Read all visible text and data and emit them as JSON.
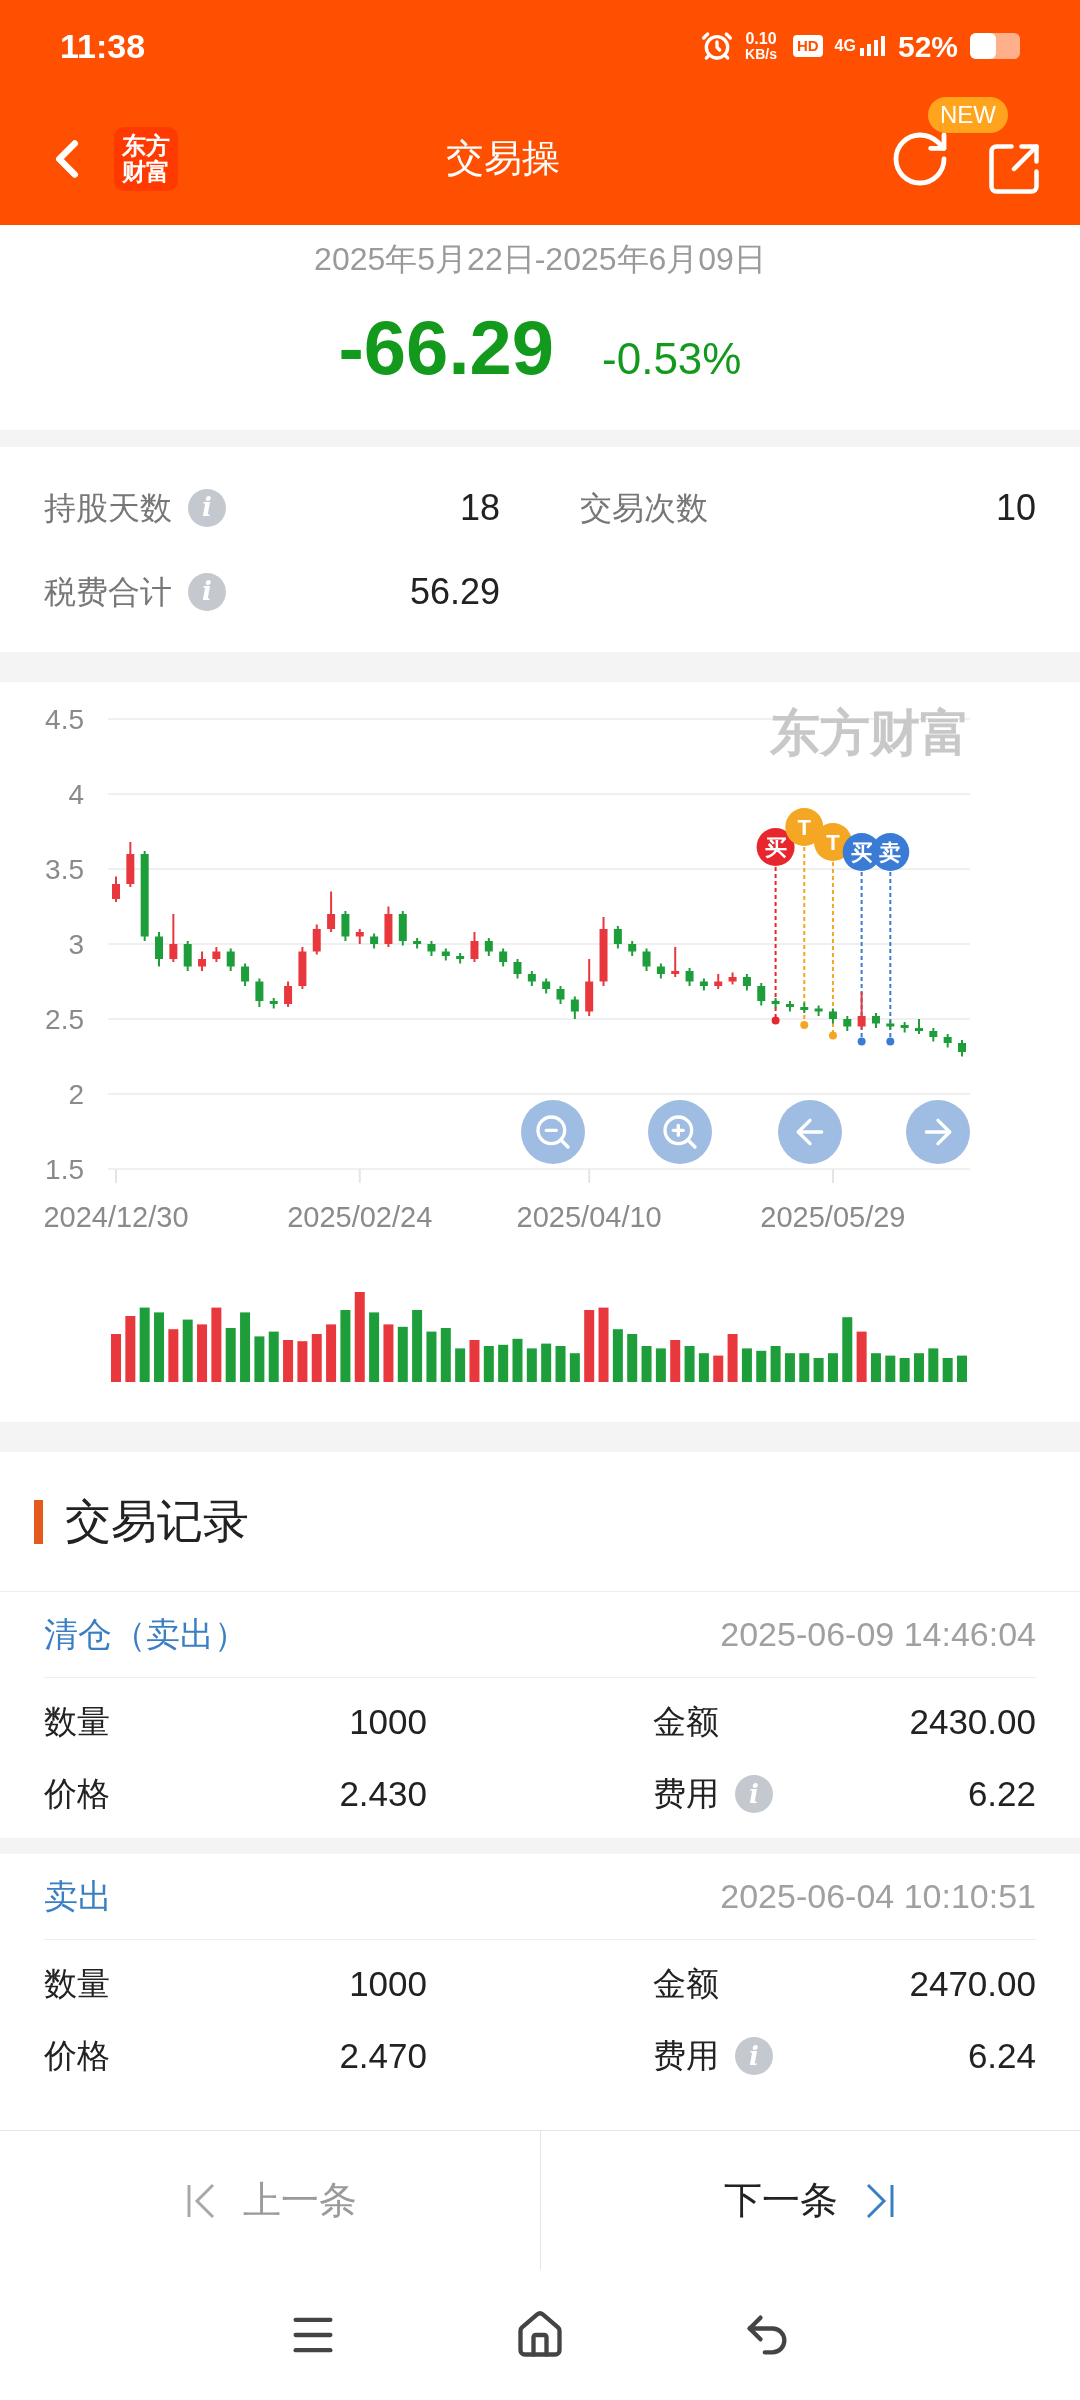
{
  "status_bar": {
    "time": "11:38",
    "net_speed": "0.10",
    "net_unit": "KB/s",
    "hd": "HD",
    "network": "4G",
    "battery": "52%"
  },
  "header": {
    "logo_top": "东方",
    "logo_bottom": "财富",
    "title": "交易操",
    "new_badge": "NEW"
  },
  "summary": {
    "date_range": "2025年5月22日-2025年6月09日",
    "profit": "-66.29",
    "profit_pct": "-0.53%"
  },
  "stats": [
    {
      "label": "持股天数",
      "info_icon": "i",
      "value": "18"
    },
    {
      "label": "交易次数",
      "value": "10"
    },
    {
      "label": "税费合计",
      "info_icon": "i",
      "value": "56.29"
    }
  ],
  "chart": {
    "watermark": "东方财富",
    "chart_data": {
      "type": "candlestick",
      "categories": [
        "2024/12/30",
        null,
        null,
        null,
        null,
        null,
        null,
        null,
        null,
        null,
        null,
        null,
        null,
        null,
        null,
        null,
        null,
        "2025/02/24",
        null,
        null,
        null,
        null,
        null,
        null,
        null,
        null,
        null,
        null,
        null,
        null,
        null,
        null,
        null,
        "2025/04/10",
        null,
        null,
        null,
        null,
        null,
        null,
        null,
        null,
        null,
        null,
        null,
        null,
        null,
        null,
        null,
        null,
        "2025/05/29",
        null,
        null,
        null,
        null,
        null,
        null,
        null,
        null,
        null
      ],
      "ohlc": [
        [
          3.3,
          3.45,
          3.28,
          3.4
        ],
        [
          3.4,
          3.68,
          3.38,
          3.6
        ],
        [
          3.6,
          3.62,
          3.02,
          3.05
        ],
        [
          3.05,
          3.08,
          2.85,
          2.9
        ],
        [
          2.9,
          3.2,
          2.88,
          3.0
        ],
        [
          3.0,
          3.02,
          2.82,
          2.85
        ],
        [
          2.85,
          2.95,
          2.82,
          2.9
        ],
        [
          2.9,
          2.98,
          2.88,
          2.95
        ],
        [
          2.95,
          2.97,
          2.82,
          2.85
        ],
        [
          2.85,
          2.87,
          2.72,
          2.75
        ],
        [
          2.75,
          2.77,
          2.58,
          2.62
        ],
        [
          2.62,
          2.64,
          2.57,
          2.6
        ],
        [
          2.6,
          2.75,
          2.58,
          2.72
        ],
        [
          2.72,
          2.98,
          2.7,
          2.95
        ],
        [
          2.95,
          3.13,
          2.93,
          3.1
        ],
        [
          3.1,
          3.35,
          3.08,
          3.2
        ],
        [
          3.2,
          3.22,
          3.02,
          3.05
        ],
        [
          3.05,
          3.1,
          3.0,
          3.08
        ],
        [
          3.05,
          3.07,
          2.97,
          3.0
        ],
        [
          3.0,
          3.25,
          2.98,
          3.2
        ],
        [
          3.2,
          3.22,
          2.99,
          3.02
        ],
        [
          3.02,
          3.04,
          2.97,
          3.0
        ],
        [
          3.0,
          3.02,
          2.92,
          2.95
        ],
        [
          2.95,
          2.97,
          2.89,
          2.92
        ],
        [
          2.92,
          2.94,
          2.87,
          2.9
        ],
        [
          2.9,
          3.08,
          2.88,
          3.02
        ],
        [
          3.02,
          3.04,
          2.92,
          2.95
        ],
        [
          2.95,
          2.97,
          2.85,
          2.88
        ],
        [
          2.88,
          2.9,
          2.77,
          2.8
        ],
        [
          2.8,
          2.82,
          2.72,
          2.75
        ],
        [
          2.75,
          2.77,
          2.67,
          2.7
        ],
        [
          2.7,
          2.72,
          2.6,
          2.63
        ],
        [
          2.63,
          2.65,
          2.5,
          2.55
        ],
        [
          2.55,
          2.9,
          2.52,
          2.75
        ],
        [
          2.75,
          3.18,
          2.72,
          3.1
        ],
        [
          3.1,
          3.12,
          2.97,
          3.0
        ],
        [
          3.0,
          3.02,
          2.92,
          2.95
        ],
        [
          2.95,
          2.97,
          2.82,
          2.85
        ],
        [
          2.85,
          2.87,
          2.77,
          2.8
        ],
        [
          2.8,
          2.98,
          2.78,
          2.82
        ],
        [
          2.82,
          2.84,
          2.72,
          2.75
        ],
        [
          2.75,
          2.77,
          2.69,
          2.72
        ],
        [
          2.72,
          2.8,
          2.7,
          2.75
        ],
        [
          2.75,
          2.81,
          2.73,
          2.78
        ],
        [
          2.78,
          2.8,
          2.69,
          2.72
        ],
        [
          2.72,
          2.74,
          2.59,
          2.62
        ],
        [
          2.62,
          2.64,
          2.57,
          2.6
        ],
        [
          2.6,
          2.62,
          2.55,
          2.58
        ],
        [
          2.58,
          2.61,
          2.54,
          2.57
        ],
        [
          2.57,
          2.59,
          2.52,
          2.55
        ],
        [
          2.55,
          2.57,
          2.47,
          2.5
        ],
        [
          2.5,
          2.52,
          2.42,
          2.45
        ],
        [
          2.45,
          2.68,
          2.43,
          2.52
        ],
        [
          2.52,
          2.54,
          2.44,
          2.47
        ],
        [
          2.47,
          2.49,
          2.43,
          2.46
        ],
        [
          2.46,
          2.48,
          2.41,
          2.44
        ],
        [
          2.44,
          2.5,
          2.4,
          2.42
        ],
        [
          2.42,
          2.44,
          2.35,
          2.38
        ],
        [
          2.38,
          2.4,
          2.31,
          2.34
        ],
        [
          2.34,
          2.36,
          2.25,
          2.28
        ]
      ],
      "grid": true,
      "ylim": [
        1.5,
        4.5
      ],
      "yticks": [
        1.5,
        2,
        2.5,
        3,
        3.5,
        4,
        4.5
      ]
    },
    "markers": [
      {
        "label": "买",
        "color": "#e8262e"
      },
      {
        "label": "T",
        "color": "#f5a623"
      },
      {
        "label": "T",
        "color": "#f5a623"
      },
      {
        "label": "买",
        "color": "#3a7bd5"
      },
      {
        "label": "卖",
        "color": "#3a7bd5"
      }
    ]
  },
  "records": {
    "title": "交易记录",
    "items": [
      {
        "type": "清仓（卖出）",
        "time": "2025-06-09 14:46:04",
        "fields": [
          {
            "label": "数量",
            "value": "1000"
          },
          {
            "label": "金额",
            "value": "2430.00"
          },
          {
            "label": "价格",
            "value": "2.430"
          },
          {
            "label": "费用",
            "info_icon": "i",
            "value": "6.22"
          }
        ]
      },
      {
        "type": "卖出",
        "time": "2025-06-04 10:10:51",
        "fields": [
          {
            "label": "数量",
            "value": "1000"
          },
          {
            "label": "金额",
            "value": "2470.00"
          },
          {
            "label": "价格",
            "value": "2.470"
          },
          {
            "label": "费用",
            "info_icon": "i",
            "value": "6.24"
          }
        ]
      }
    ]
  },
  "pager": [
    {
      "label": "上一条",
      "disabled": true,
      "kind": "prev"
    },
    {
      "label": "下一条",
      "disabled": false,
      "kind": "next"
    }
  ]
}
